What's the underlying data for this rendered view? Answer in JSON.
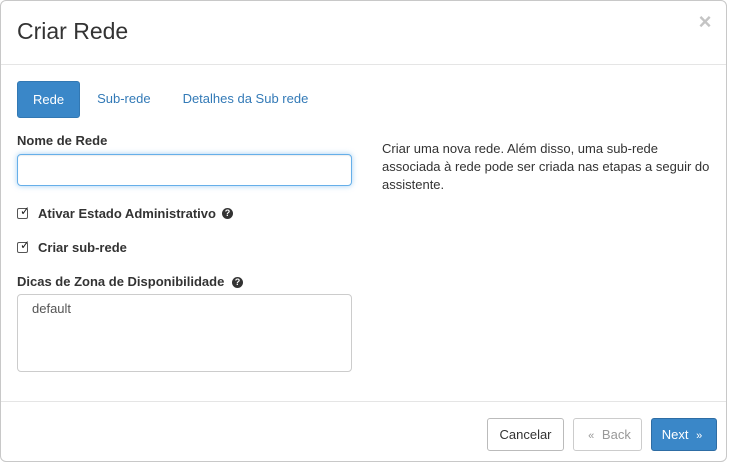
{
  "modal": {
    "title": "Criar Rede",
    "close_symbol": "×"
  },
  "tabs": [
    {
      "label": "Rede",
      "active": true
    },
    {
      "label": "Sub-rede",
      "active": false
    },
    {
      "label": "Detalhes da Sub rede",
      "active": false
    }
  ],
  "form": {
    "network_name_label": "Nome de Rede",
    "network_name_value": "",
    "admin_state_label": "Ativar Estado Administrativo",
    "admin_state_checked": true,
    "create_subnet_label": "Criar sub-rede",
    "create_subnet_checked": true,
    "az_hints_label": "Dicas de Zona de Disponibilidade",
    "az_hints_options": [
      "default"
    ]
  },
  "help_text": "Criar uma nova rede. Além disso, uma sub-rede associada à rede pode ser criada nas etapas a seguir do assistente.",
  "footer": {
    "cancel_label": "Cancelar",
    "back_label": "Back",
    "next_label": "Next",
    "back_chevron": "«",
    "next_chevron": "»"
  },
  "icons": {
    "help": "question-circle-icon",
    "check": "check-icon",
    "close": "close-icon"
  },
  "colors": {
    "primary": "#3a87c8",
    "link": "#337ab7",
    "focus_border": "#66afe9"
  }
}
